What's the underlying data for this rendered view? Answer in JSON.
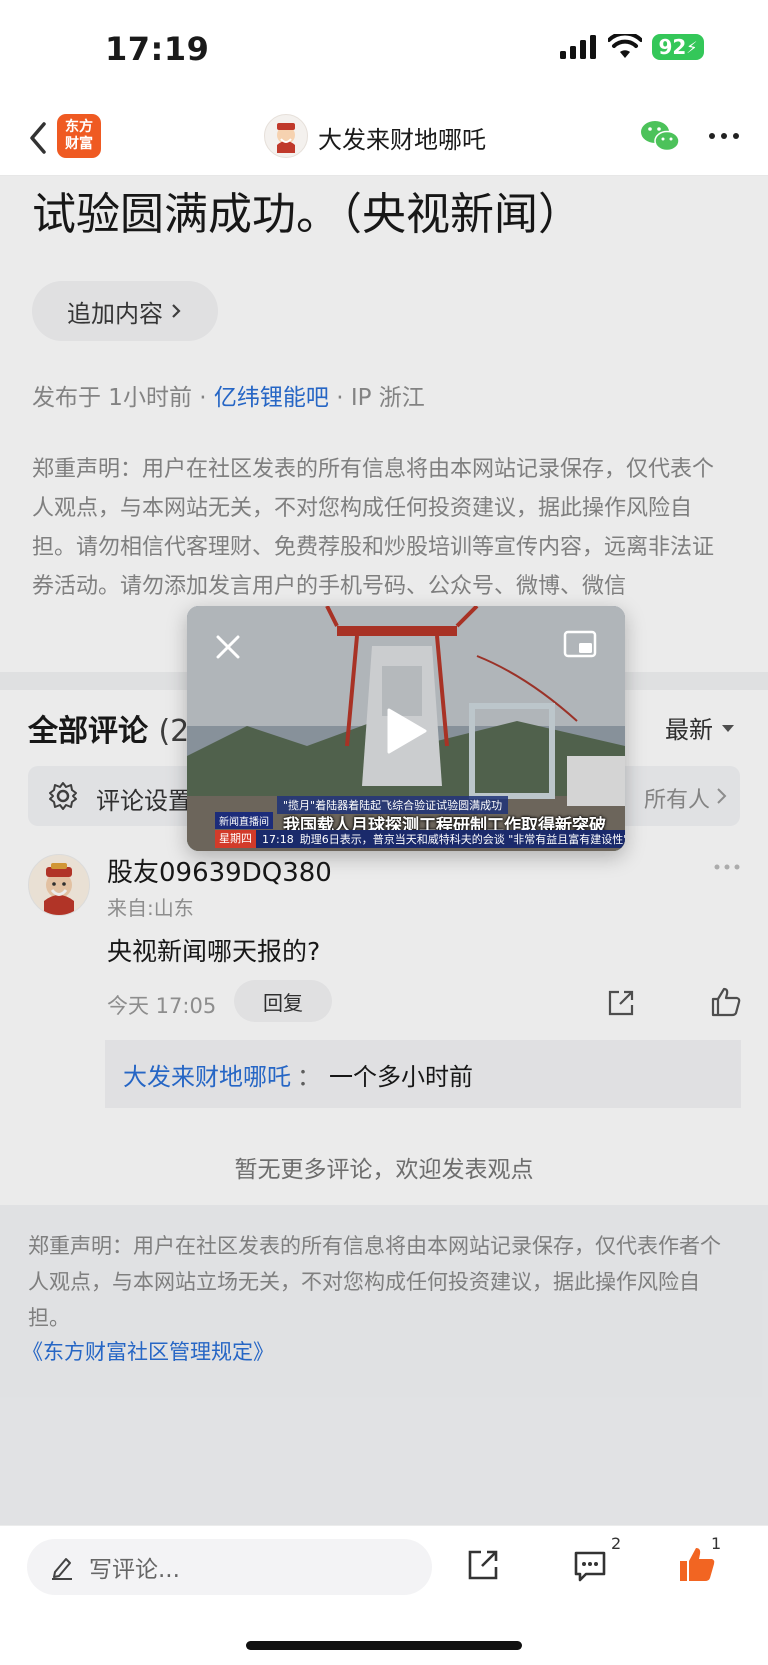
{
  "status_bar": {
    "time": "17:19",
    "battery": "92"
  },
  "nav": {
    "logo_line1": "东方",
    "logo_line2": "财富",
    "title": "大发来财地哪吒"
  },
  "article": {
    "headline": "试验圆满成功。（央视新闻）",
    "add_content_label": "追加内容",
    "meta": {
      "published": "发布于 1小时前",
      "dot1": " · ",
      "board": "亿纬锂能吧",
      "dot2": " · ",
      "ip": "IP 浙江"
    },
    "disclaimer": "郑重声明：用户在社区发表的所有信息将由本网站记录保存，仅代表个人观点，与本网站无关，不对您构成任何投资建议，据此操作风险自担。请勿相信代客理财、免费荐股和炒股培训等宣传内容，远离非法证券活动。请勿添加发言用户的手机号码、公众号、微博、微信"
  },
  "comments": {
    "title": "全部评论",
    "count": "(2",
    "sort_label": "最新",
    "settings_label": "评论设置",
    "settings_right": "所有人",
    "items": [
      {
        "user": "股友09639DQ380",
        "location": "来自:山东",
        "text": "央视新闻哪天报的?",
        "time": "今天 17:05",
        "reply_button": "回复",
        "reply": {
          "author": "大发来财地哪吒",
          "sep": "：",
          "text": "一个多小时前"
        }
      }
    ],
    "no_more": "暂无更多评论，欢迎发表观点"
  },
  "footer": {
    "disclaimer": "郑重声明：用户在社区发表的所有信息将由本网站记录保存，仅代表作者个人观点，与本网站立场无关，不对您构成任何投资建议，据此操作风险自担。",
    "rules_link": "《东方财富社区管理规定》"
  },
  "toolbar": {
    "input_placeholder": "写评论...",
    "comments_badge": "2",
    "likes_badge": "1"
  },
  "video": {
    "caption_sub": "\"揽月\"着陆器着陆起飞综合验证试验圆满成功",
    "caption_main": "我国载人月球探测工程研制工作取得新突破",
    "news_left": "新闻直播间",
    "ticker_day": "星期四",
    "ticker_time": "17:18",
    "ticker_text": "助理6日表示，普京当天和威特科夫的会谈 \"非常有益且富有建设性\""
  },
  "colors": {
    "brand": "#ef5a22",
    "link": "#2a6fd6",
    "like": "#f26522",
    "wechat": "#4cc25a"
  }
}
